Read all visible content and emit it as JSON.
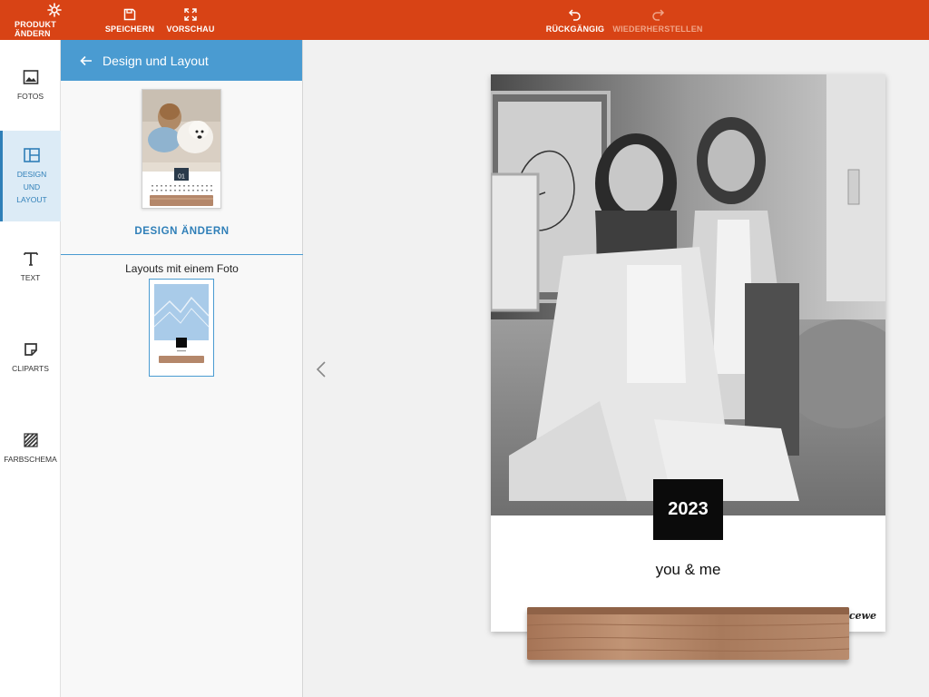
{
  "toolbar": {
    "change_product": "PRODUKT ÄNDERN",
    "save": "SPEICHERN",
    "preview": "VORSCHAU",
    "undo": "RÜCKGÄNGIG",
    "redo": "WIEDERHERSTELLEN",
    "background_color": "#d84315"
  },
  "rail": {
    "items": [
      {
        "label": "FOTOS",
        "icon": "image-icon"
      },
      {
        "label": "DESIGN\nUND\nLAYOUT",
        "icon": "layout-icon",
        "active": true
      },
      {
        "label": "TEXT",
        "icon": "text-icon"
      },
      {
        "label": "CLIPARTS",
        "icon": "clipart-icon"
      },
      {
        "label": "FARBSCHEMA",
        "icon": "color-scheme-icon"
      }
    ],
    "labels": {
      "fotos": "FOTOS",
      "design_1": "DESIGN",
      "design_2": "UND",
      "design_3": "LAYOUT",
      "text": "TEXT",
      "cliparts": "CLIPARTS",
      "farbschema": "FARBSCHEMA"
    }
  },
  "panel": {
    "title": "Design und Layout",
    "thumb_month": "01",
    "change_design": "DESIGN ÄNDERN",
    "layouts_label": "Layouts mit einem Foto"
  },
  "canvas": {
    "year": "2023",
    "subtitle": "you & me",
    "brand": "cewe"
  },
  "colors": {
    "accent": "#2f7fb8",
    "panel_header": "#4a9bd1",
    "active_rail_bg": "#dcebf6"
  }
}
